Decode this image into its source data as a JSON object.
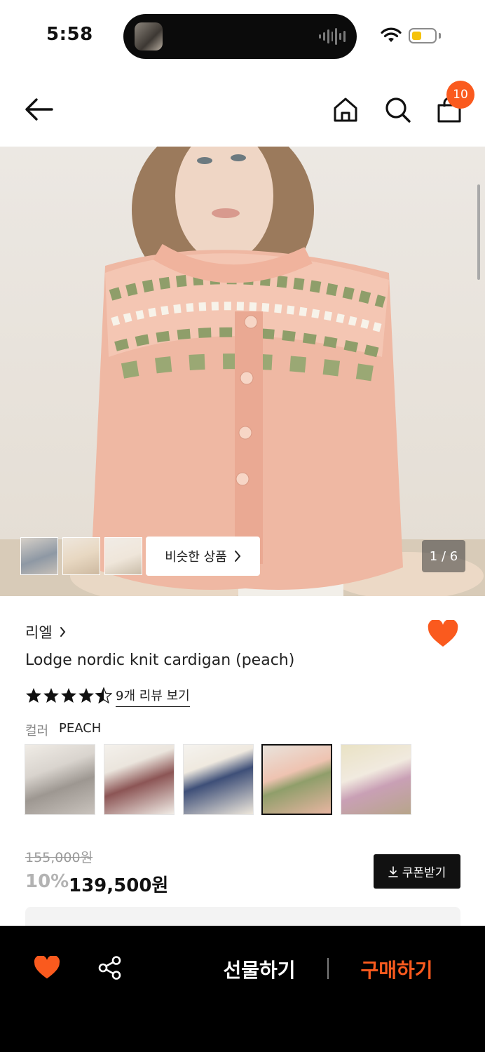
{
  "status_bar": {
    "time": "5:58"
  },
  "header": {
    "cart_count": "10"
  },
  "gallery": {
    "similar_label": "비슷한 상품",
    "page_indicator": "1 / 6"
  },
  "product": {
    "brand": "리엘",
    "title": "Lodge nordic knit cardigan (peach)",
    "rating": 4.5,
    "review_link": "9개 리뷰 보기",
    "color_label": "컬러",
    "color_value": "PEACH",
    "color_swatches": [
      "gray",
      "burgundy",
      "navy",
      "peach",
      "cream"
    ],
    "selected_swatch": "peach",
    "original_price": "155,000원",
    "discount": "10%",
    "price": "139,500원",
    "coupon_label": "쿠폰받기"
  },
  "bottom_bar": {
    "gift_label": "선물하기",
    "buy_label": "구매하기"
  },
  "colors": {
    "accent": "#fa5a1e",
    "dark": "#000000",
    "muted": "#9a9a9a"
  }
}
